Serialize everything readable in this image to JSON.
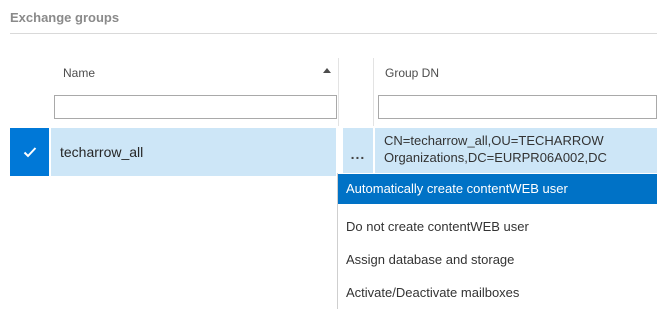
{
  "section": {
    "title": "Exchange groups"
  },
  "table": {
    "columns": [
      {
        "label": "Name",
        "sort": "ascending"
      },
      {
        "label": "Group DN"
      }
    ],
    "filters": [
      {
        "value": ""
      },
      {
        "value": ""
      }
    ],
    "rows": [
      {
        "selected": true,
        "name": "techarrow_all",
        "more_label": "...",
        "group_dn_line1": "CN=techarrow_all,OU=TECHARROW",
        "group_dn_line2": "Organizations,DC=EURPR06A002,DC"
      }
    ]
  },
  "context_menu": {
    "items": [
      {
        "label": "Automatically create contentWEB user",
        "highlighted": true
      },
      {
        "label": "Do not create contentWEB user"
      },
      {
        "label": "Assign database and storage"
      },
      {
        "label": "Activate/Deactivate mailboxes"
      }
    ]
  },
  "colors": {
    "selection_accent": "#0078d7",
    "row_highlight": "#cde6f7",
    "menu_highlight": "#0072c6",
    "section_title": "#8a8a8a"
  }
}
